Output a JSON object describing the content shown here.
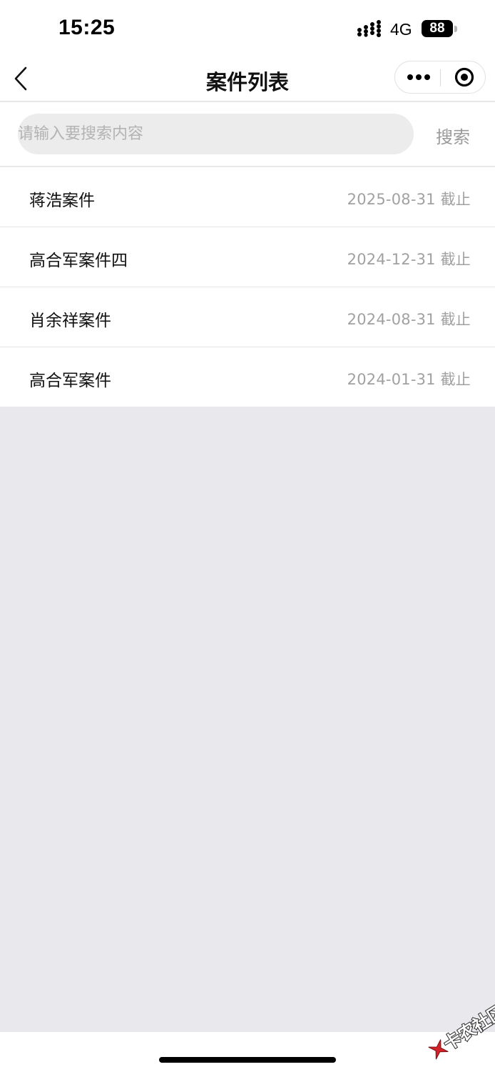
{
  "status_bar": {
    "time": "15:25",
    "network": "4G",
    "battery": "88"
  },
  "nav": {
    "title": "案件列表"
  },
  "search": {
    "placeholder": "请输入要搜索内容",
    "value": "",
    "button_label": "搜索"
  },
  "cases": [
    {
      "name": "蒋浩案件",
      "deadline": "2025-08-31 截止"
    },
    {
      "name": "高合军案件四",
      "deadline": "2024-12-31 截止"
    },
    {
      "name": "肖余祥案件",
      "deadline": "2024-08-31 截止"
    },
    {
      "name": "高合军案件",
      "deadline": "2024-01-31 截止"
    }
  ],
  "watermark": {
    "text": "卡农社区"
  },
  "colors": {
    "page_background": "#e9e8ed",
    "surface": "#ffffff",
    "placeholder_text": "#b3b3b3",
    "secondary_text": "#a1a1a1",
    "search_fill": "#ececec",
    "watermark_accent": "#d2232a"
  }
}
